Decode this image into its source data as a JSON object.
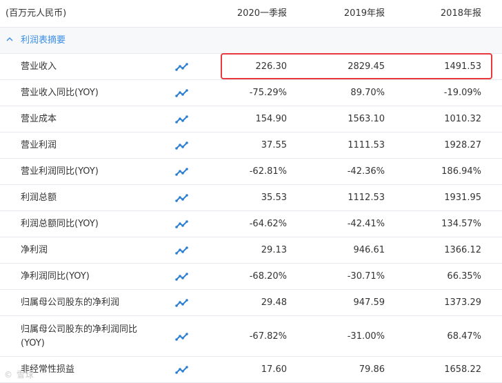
{
  "header": {
    "unit_label": "(百万元人民币)",
    "columns": [
      "2020一季报",
      "2019年报",
      "2018年报"
    ]
  },
  "section": {
    "label": "利润表摘要",
    "toggle_icon": "chevron-up-icon",
    "color": "#3a8ee6"
  },
  "trend_icon": "line-chart-icon",
  "highlight_color": "#e8383d",
  "rows": [
    {
      "label": "营业收入",
      "values": [
        "226.30",
        "2829.45",
        "1491.53"
      ]
    },
    {
      "label": "营业收入同比(YOY)",
      "values": [
        "-75.29%",
        "89.70%",
        "-19.09%"
      ]
    },
    {
      "label": "营业成本",
      "values": [
        "154.90",
        "1563.10",
        "1010.32"
      ]
    },
    {
      "label": "营业利润",
      "values": [
        "37.55",
        "1111.53",
        "1928.27"
      ]
    },
    {
      "label": "营业利润同比(YOY)",
      "values": [
        "-62.81%",
        "-42.36%",
        "186.94%"
      ]
    },
    {
      "label": "利润总额",
      "values": [
        "35.53",
        "1112.53",
        "1931.95"
      ]
    },
    {
      "label": "利润总额同比(YOY)",
      "values": [
        "-64.62%",
        "-42.41%",
        "134.57%"
      ]
    },
    {
      "label": "净利润",
      "values": [
        "29.13",
        "946.61",
        "1366.12"
      ]
    },
    {
      "label": "净利润同比(YOY)",
      "values": [
        "-68.20%",
        "-30.71%",
        "66.35%"
      ]
    },
    {
      "label": "归属母公司股东的净利润",
      "values": [
        "29.48",
        "947.59",
        "1373.29"
      ]
    },
    {
      "label": "归属母公司股东的净利润同比(YOY)",
      "values": [
        "-67.82%",
        "-31.00%",
        "68.47%"
      ]
    },
    {
      "label": "非经常性损益",
      "values": [
        "17.60",
        "79.86",
        "1658.22"
      ]
    }
  ],
  "watermark": "© 雪球"
}
